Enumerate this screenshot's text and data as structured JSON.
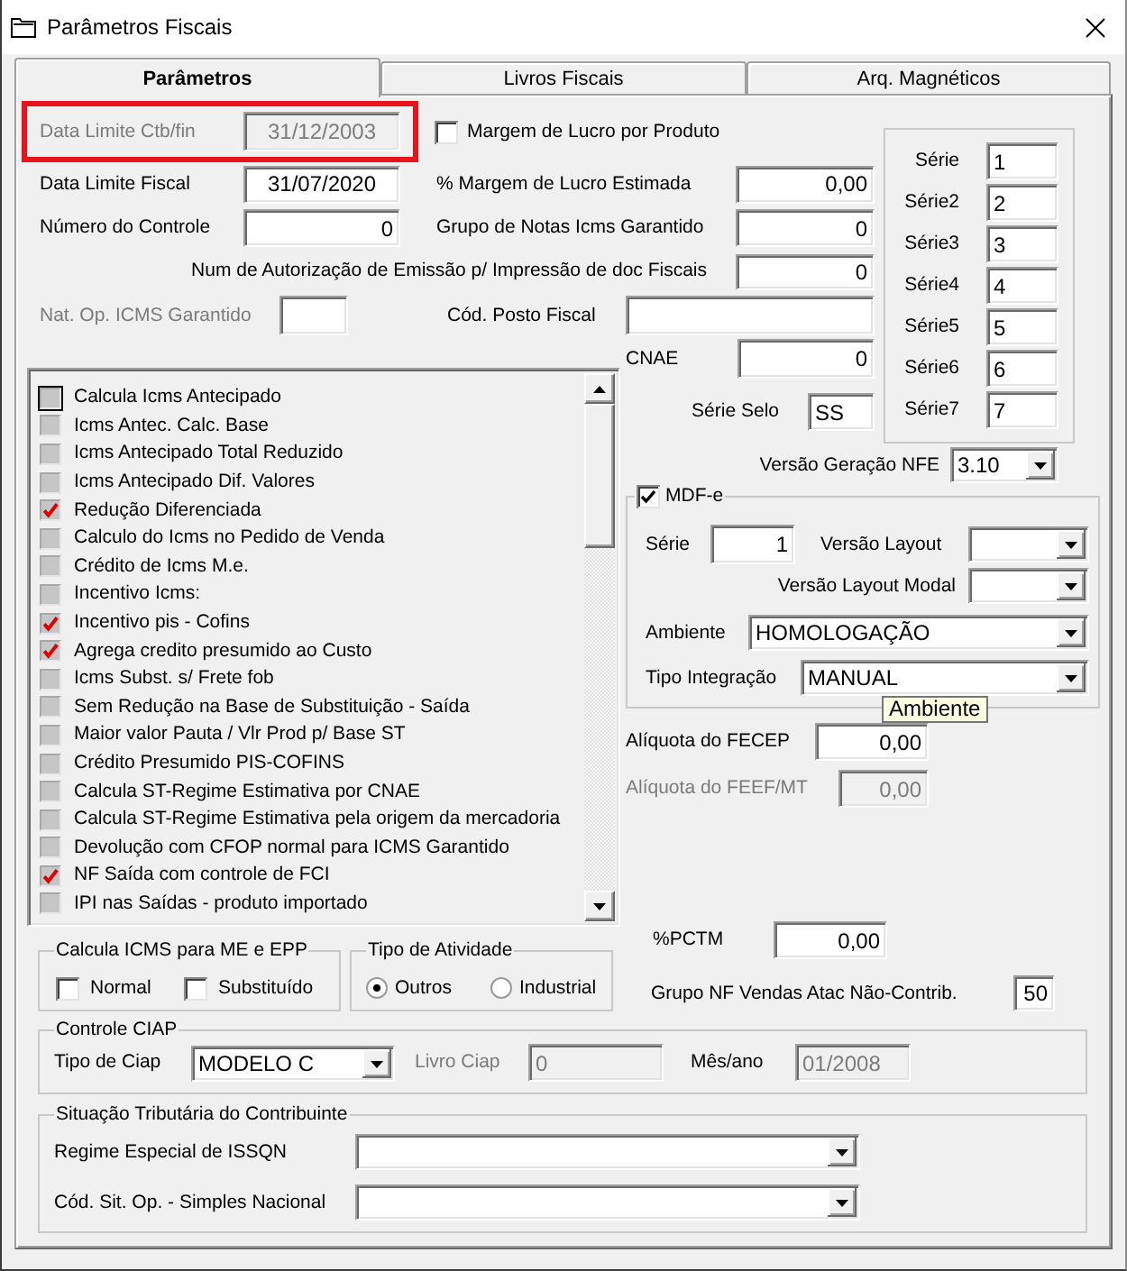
{
  "window": {
    "title": "Parâmetros Fiscais"
  },
  "tabs": [
    {
      "label": "Parâmetros",
      "selected": true
    },
    {
      "label": "Livros Fiscais",
      "selected": false
    },
    {
      "label": "Arq. Magnéticos",
      "selected": false
    }
  ],
  "left_fields": [
    {
      "label": "Data Limite Ctb/fin",
      "value": "31/12/2003",
      "kind": "date",
      "disabled": true,
      "highlighted": true
    },
    {
      "label": "Data Limite Fiscal",
      "value": "31/07/2020",
      "kind": "date",
      "disabled": false,
      "highlighted": false
    },
    {
      "label": "Número do Controle",
      "value": "0",
      "kind": "number",
      "disabled": false,
      "highlighted": false
    }
  ],
  "margem_por_produto": {
    "label": "Margem de Lucro por Produto",
    "checked": false
  },
  "middle_fields": [
    {
      "label": "% Margem de Lucro Estimada",
      "value": "0,00"
    },
    {
      "label": "Grupo de Notas Icms Garantido",
      "value": "0"
    }
  ],
  "num_autorizacao": {
    "label": "Num de Autorização de Emissão p/ Impressão de doc Fiscais",
    "value": "0"
  },
  "nat_op_icms_garantido": {
    "label": "Nat. Op. ICMS Garantido",
    "label_disabled": true
  },
  "cod_posto_fiscal": {
    "label": "Cód. Posto Fiscal"
  },
  "series": [
    {
      "label": "Série",
      "value": "1"
    },
    {
      "label": "Série2",
      "value": "2"
    },
    {
      "label": "Série3",
      "value": "3"
    },
    {
      "label": "Série4",
      "value": "4"
    },
    {
      "label": "Série5",
      "value": "5"
    },
    {
      "label": "Série6",
      "value": "6"
    },
    {
      "label": "Série7",
      "value": "7"
    }
  ],
  "cnae": {
    "label": "CNAE",
    "value": "0"
  },
  "serie_selo": {
    "label": "Série Selo",
    "value": "SS"
  },
  "options_list": [
    {
      "label": "Calcula Icms Antecipado",
      "checked": false,
      "focused": true
    },
    {
      "label": "Icms Antec. Calc. Base",
      "checked": false,
      "focused": false
    },
    {
      "label": "Icms Antecipado Total Reduzido",
      "checked": false,
      "focused": false
    },
    {
      "label": "Icms Antecipado Dif. Valores",
      "checked": false,
      "focused": false
    },
    {
      "label": "Redução Diferenciada",
      "checked": true,
      "focused": false
    },
    {
      "label": "Calculo do Icms no Pedido de Venda",
      "checked": false,
      "focused": false
    },
    {
      "label": "Crédito de Icms M.e.",
      "checked": false,
      "focused": false
    },
    {
      "label": "Incentivo Icms:",
      "checked": false,
      "focused": false
    },
    {
      "label": "Incentivo pis - Cofins",
      "checked": true,
      "focused": false
    },
    {
      "label": "Agrega credito presumido ao Custo",
      "checked": true,
      "focused": false
    },
    {
      "label": "Icms Subst. s/ Frete fob",
      "checked": false,
      "focused": false
    },
    {
      "label": "Sem Redução na Base de Substituição - Saída",
      "checked": false,
      "focused": false
    },
    {
      "label": "Maior valor Pauta / Vlr Prod p/ Base ST",
      "checked": false,
      "focused": false
    },
    {
      "label": "Crédito Presumido PIS-COFINS",
      "checked": false,
      "focused": false
    },
    {
      "label": "Calcula ST-Regime Estimativa por CNAE",
      "checked": false,
      "focused": false
    },
    {
      "label": "Calcula ST-Regime Estimativa pela origem da mercadoria",
      "checked": false,
      "focused": false
    },
    {
      "label": "Devolução com CFOP normal para ICMS Garantido",
      "checked": false,
      "focused": false
    },
    {
      "label": "NF Saída com controle de FCI",
      "checked": true,
      "focused": false
    },
    {
      "label": "IPI nas Saídas - produto importado",
      "checked": false,
      "focused": false
    }
  ],
  "versao_nfe": {
    "label": "Versão Geração NFE",
    "value": "3.10"
  },
  "mdfe": {
    "label": "MDF-e",
    "checked": true,
    "serie": {
      "label": "Série",
      "value": "1"
    },
    "versao_layout": {
      "label": "Versão Layout"
    },
    "versao_layout_modal": {
      "label": "Versão Layout Modal"
    },
    "ambiente": {
      "label": "Ambiente",
      "value": "HOMOLOGAÇÃO"
    },
    "tipo_integracao": {
      "label": "Tipo Integração",
      "value": "MANUAL"
    }
  },
  "tooltip": {
    "text": "Ambiente"
  },
  "aliquotas": [
    {
      "label": "Alíquota do FECEP",
      "value": "0,00",
      "disabled": false
    },
    {
      "label": "Alíquota do FEEF/MT",
      "value": "0,00",
      "disabled": true
    }
  ],
  "pctm": {
    "label": "%PCTM",
    "value": "0,00"
  },
  "grupo_nf_vendas": {
    "label": "Grupo NF Vendas Atac Não-Contrib.",
    "value": "50"
  },
  "calcula_icms_me_epp": {
    "title": "Calcula ICMS para ME e EPP",
    "options": [
      {
        "label": "Normal",
        "checked": false
      },
      {
        "label": "Substituído",
        "checked": false
      }
    ]
  },
  "tipo_atividade": {
    "title": "Tipo de Atividade",
    "options": [
      {
        "label": "Outros",
        "selected": true
      },
      {
        "label": "Industrial",
        "selected": false
      }
    ]
  },
  "controle_ciap": {
    "title": "Controle CIAP",
    "tipo": {
      "label": "Tipo de Ciap",
      "value": "MODELO C"
    },
    "livro": {
      "label": "Livro Ciap",
      "value": "0",
      "disabled": true
    },
    "mes_ano": {
      "label": "Mês/ano",
      "value": "01/2008",
      "disabled": true,
      "label_disabled": false
    }
  },
  "situacao_tributaria": {
    "title": "Situação Tributária do Contribuinte",
    "fields": [
      {
        "label": "Regime Especial de ISSQN"
      },
      {
        "label": "Cód. Sit. Op. - Simples Nacional"
      }
    ]
  }
}
